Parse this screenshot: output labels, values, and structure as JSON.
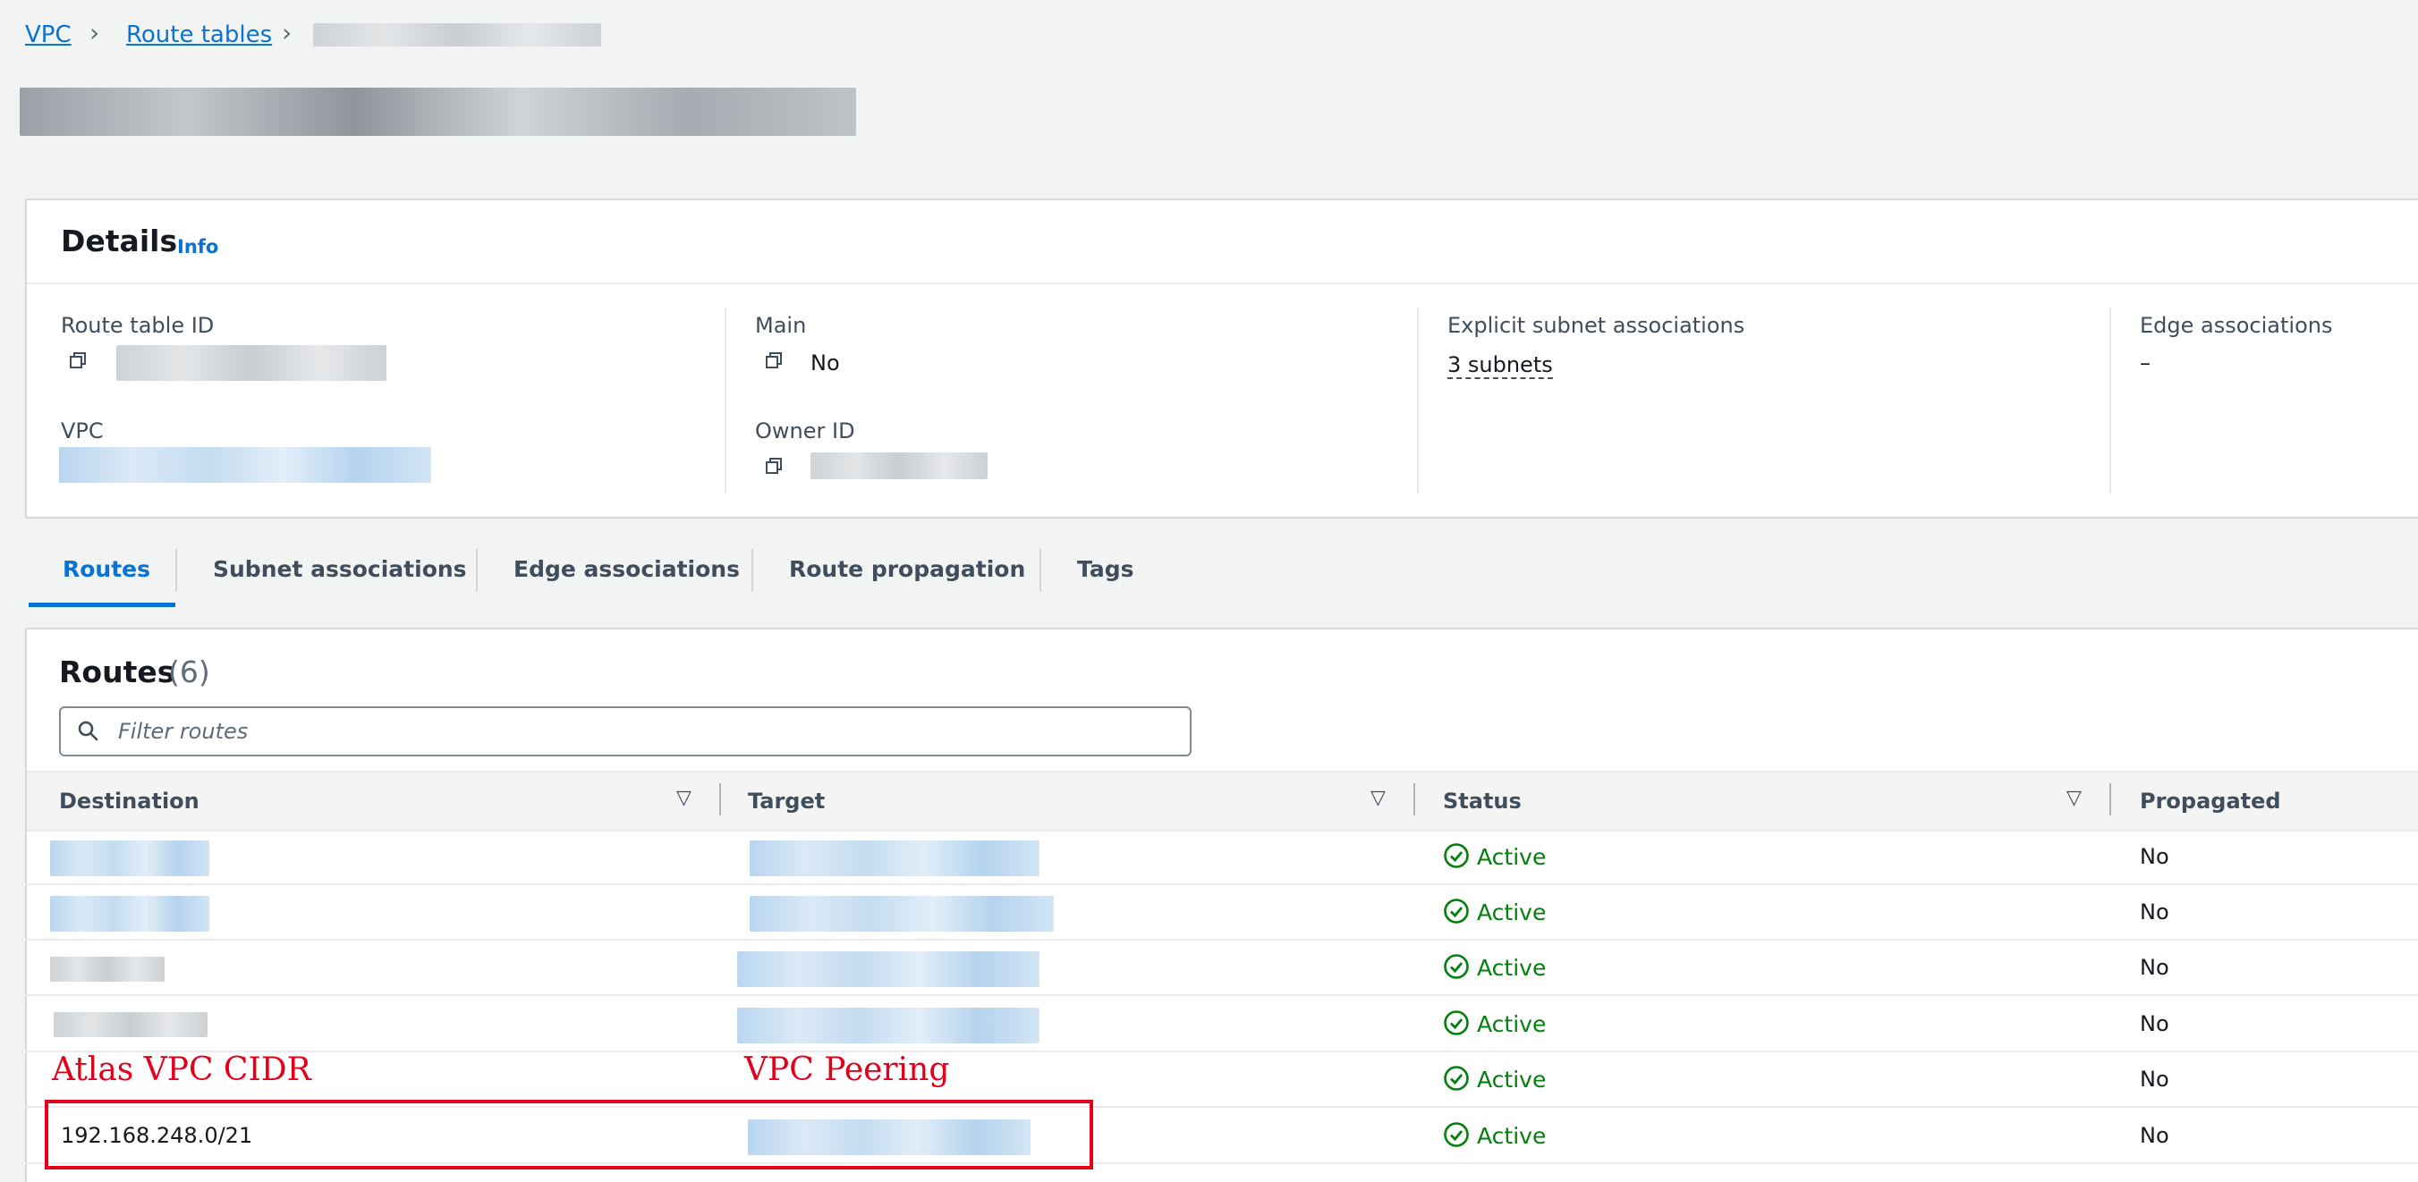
{
  "breadcrumb": {
    "items": [
      "VPC",
      "Route tables"
    ]
  },
  "details": {
    "title": "Details",
    "info": "Info",
    "route_table_id_label": "Route table ID",
    "main_label": "Main",
    "main_value": "No",
    "explicit_label": "Explicit subnet associations",
    "explicit_value": "3 subnets",
    "edge_label": "Edge associations",
    "edge_value": "–",
    "vpc_label": "VPC",
    "owner_label": "Owner ID"
  },
  "tabs": [
    "Routes",
    "Subnet associations",
    "Edge associations",
    "Route propagation",
    "Tags"
  ],
  "routes": {
    "title": "Routes",
    "count": "(6)",
    "filter_placeholder": "Filter routes",
    "columns": [
      "Destination",
      "Target",
      "Status",
      "Propagated"
    ],
    "rows": [
      {
        "status": "Active",
        "propagated": "No"
      },
      {
        "status": "Active",
        "propagated": "No"
      },
      {
        "status": "Active",
        "propagated": "No"
      },
      {
        "status": "Active",
        "propagated": "No"
      },
      {
        "status": "Active",
        "propagated": "No"
      },
      {
        "destination": "192.168.248.0/21",
        "status": "Active",
        "propagated": "No"
      }
    ]
  },
  "annotations": {
    "destination_note": "Atlas VPC CIDR",
    "target_note": "VPC Peering"
  },
  "colors": {
    "link": "#0972d3",
    "status_active": "#037f0c",
    "annotation": "#e4001a"
  }
}
